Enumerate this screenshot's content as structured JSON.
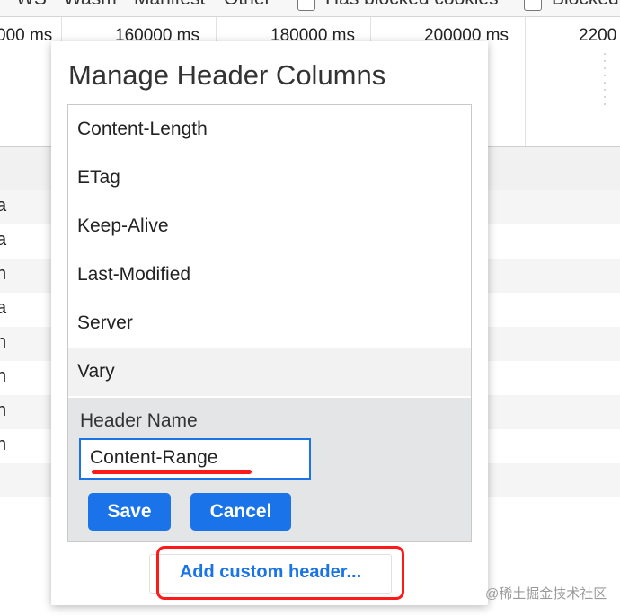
{
  "toolbar": {
    "filters": [
      "WS",
      "Wasm",
      "Manifest",
      "Other"
    ],
    "blocked_cookies_label": "Has blocked cookies",
    "blocked_requests_label": "Blocked"
  },
  "timeline": {
    "ticks": [
      "000 ms",
      "160000 ms",
      "180000 ms",
      "200000 ms",
      "2200"
    ]
  },
  "rows": [
    "a",
    "a",
    "n",
    "a",
    "n",
    "n",
    "n",
    "n"
  ],
  "dialog": {
    "title": "Manage Header Columns",
    "headers": [
      "Content-Length",
      "ETag",
      "Keep-Alive",
      "Last-Modified",
      "Server",
      "Vary"
    ],
    "editor": {
      "label": "Header Name",
      "value": "Content-Range",
      "save_label": "Save",
      "cancel_label": "Cancel"
    },
    "add_button_label": "Add custom header..."
  },
  "watermark": "@稀土掘金技术社区",
  "colors": {
    "accent": "#1a73e8",
    "annotation": "#ff1a1a",
    "editor_bg": "#e4e5e7"
  }
}
